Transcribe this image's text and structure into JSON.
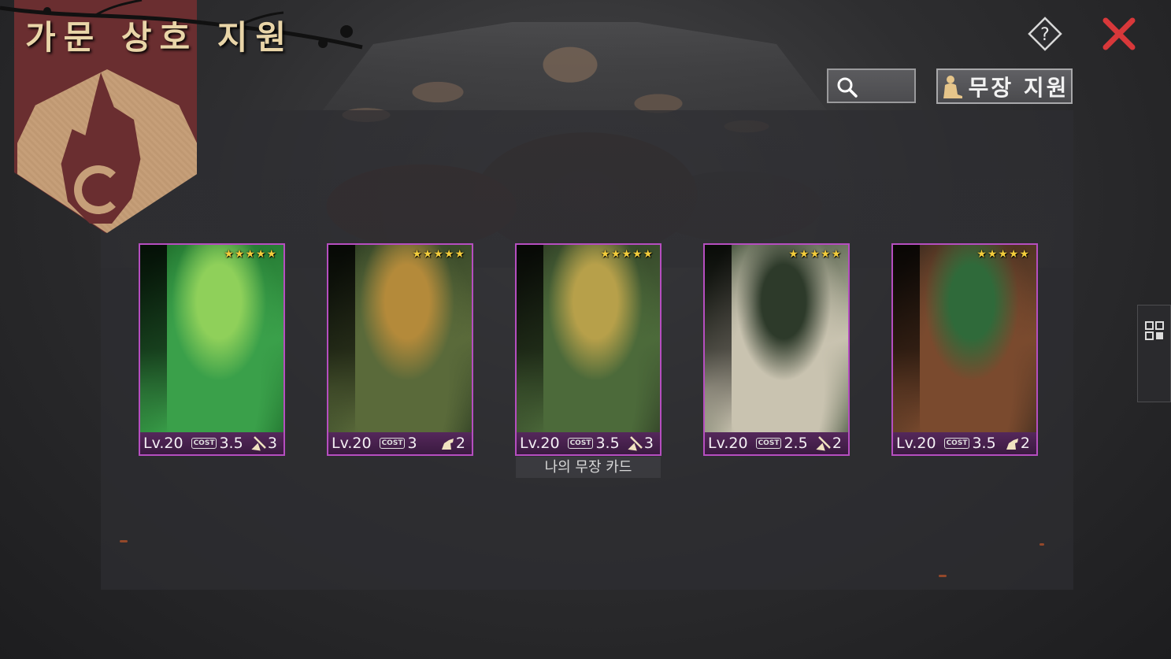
{
  "header": {
    "title": "가문 상호 지원",
    "support_button_label": "무장 지원",
    "help_symbol": "?",
    "search_placeholder": ""
  },
  "cards": [
    {
      "level": "Lv.20",
      "cost_icon": "COST",
      "cost": "3.5",
      "stars": "★★★★★",
      "unit_icon": "spearman-icon",
      "unit_count": "3",
      "art_colors": [
        "#1d6b2a",
        "#3aa04a",
        "#8fd05a"
      ]
    },
    {
      "level": "Lv.20",
      "cost_icon": "COST",
      "cost": "3",
      "stars": "★★★★★",
      "unit_icon": "cavalry-icon",
      "unit_count": "2",
      "art_colors": [
        "#2a3a22",
        "#5a6a3a",
        "#b48a3a"
      ]
    },
    {
      "level": "Lv.20",
      "cost_icon": "COST",
      "cost": "3.5",
      "stars": "★★★★★",
      "unit_icon": "spearman-icon",
      "unit_count": "3",
      "art_colors": [
        "#2d3a24",
        "#4c6a3a",
        "#b7a04a"
      ]
    },
    {
      "level": "Lv.20",
      "cost_icon": "COST",
      "cost": "2.5",
      "stars": "★★★★★",
      "unit_icon": "spearman-icon",
      "unit_count": "2",
      "art_colors": [
        "#3a4a34",
        "#c9c3b0",
        "#2d3a2a"
      ]
    },
    {
      "level": "Lv.20",
      "cost_icon": "COST",
      "cost": "3.5",
      "stars": "★★★★★",
      "unit_icon": "cavalry-icon",
      "unit_count": "2",
      "art_colors": [
        "#3a2a1e",
        "#7a4a2e",
        "#2f6a3a"
      ]
    }
  ],
  "my_card_label": "나의 무장 카드",
  "colors": {
    "card_border": "#b64ec0",
    "title_gold": "#e9d5a8",
    "close_red": "#d8383a",
    "banner_red": "#6a2e30",
    "banner_tan": "#c69f79"
  }
}
